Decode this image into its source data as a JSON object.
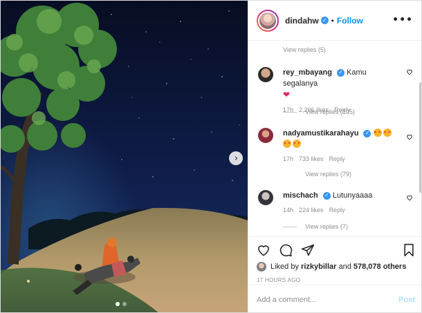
{
  "post": {
    "username": "dindahw",
    "verified_mark": "✓",
    "separator": "•",
    "follow_label": "Follow",
    "more_icon": "more-horizontal-icon",
    "nav_next_glyph": "›"
  },
  "comments": {
    "view_replies_top": "View replies (5)",
    "items": [
      {
        "username": "rey_mbayang",
        "text": "Kamu segalanya",
        "emoji": "❤",
        "time": "17h",
        "likes": "2,206 likes",
        "reply_label": "Reply",
        "view_replies": "View replies (105)"
      },
      {
        "username": "nadyamustikarahayu",
        "text": "",
        "emoji_label": "star-struck-emoji",
        "time": "17h",
        "likes": "733 likes",
        "reply_label": "Reply",
        "view_replies": "View replies (79)"
      },
      {
        "username": "mischach",
        "text": "Lutunyaaaa",
        "time": "14h",
        "likes": "224 likes",
        "reply_label": "Reply",
        "view_replies": "View replies (7)"
      }
    ]
  },
  "actions": {
    "like_icon": "heart-icon",
    "comment_icon": "comment-icon",
    "share_icon": "share-icon",
    "save_icon": "bookmark-icon",
    "liked_prefix": "Liked by",
    "liked_user": "rizkybillar",
    "liked_and": "and",
    "liked_others": "578,078 others",
    "timestamp": "17 HOURS AGO"
  },
  "add_comment": {
    "placeholder": "Add a comment...",
    "post_label": "Post"
  },
  "colors": {
    "accent": "#0095f6",
    "verified": "#3897f0",
    "heart": "#e0245e",
    "post_disabled": "#b2dffc"
  }
}
